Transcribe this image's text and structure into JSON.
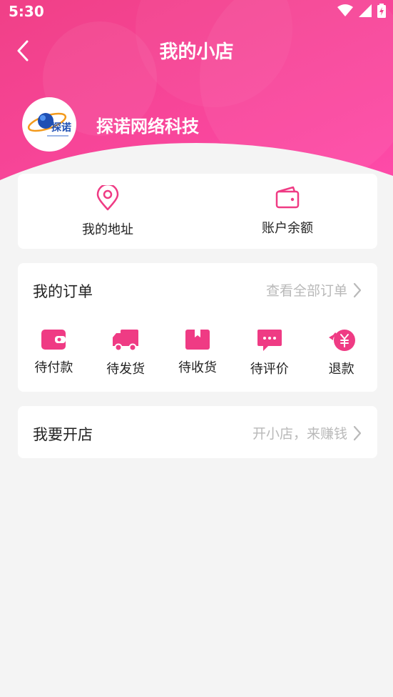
{
  "status": {
    "time": "5:30",
    "icons": [
      "wifi-icon",
      "signal-icon",
      "battery-icon"
    ]
  },
  "nav": {
    "title": "我的小店",
    "back_icon": "back-arrow-icon"
  },
  "shop": {
    "name": "探诺网络科技",
    "logo_text": "探诺"
  },
  "quick": [
    {
      "label": "我的地址",
      "icon": "location-pin-icon"
    },
    {
      "label": "账户余额",
      "icon": "wallet-icon"
    }
  ],
  "orders": {
    "title": "我的订单",
    "more": "查看全部订单",
    "items": [
      {
        "label": "待付款",
        "icon": "wallet-fill-icon"
      },
      {
        "label": "待发货",
        "icon": "truck-icon"
      },
      {
        "label": "待收货",
        "icon": "box-icon"
      },
      {
        "label": "待评价",
        "icon": "chat-icon"
      },
      {
        "label": "退款",
        "icon": "refund-yuan-icon"
      }
    ]
  },
  "open_shop": {
    "title": "我要开店",
    "hint": "开小店，来赚钱"
  },
  "colors": {
    "brand": "#ef3b84",
    "header_gradient_start": "#f1408a",
    "header_gradient_end": "#ff4fae",
    "muted_text": "#b9b9b9",
    "background": "#f4f4f4"
  }
}
